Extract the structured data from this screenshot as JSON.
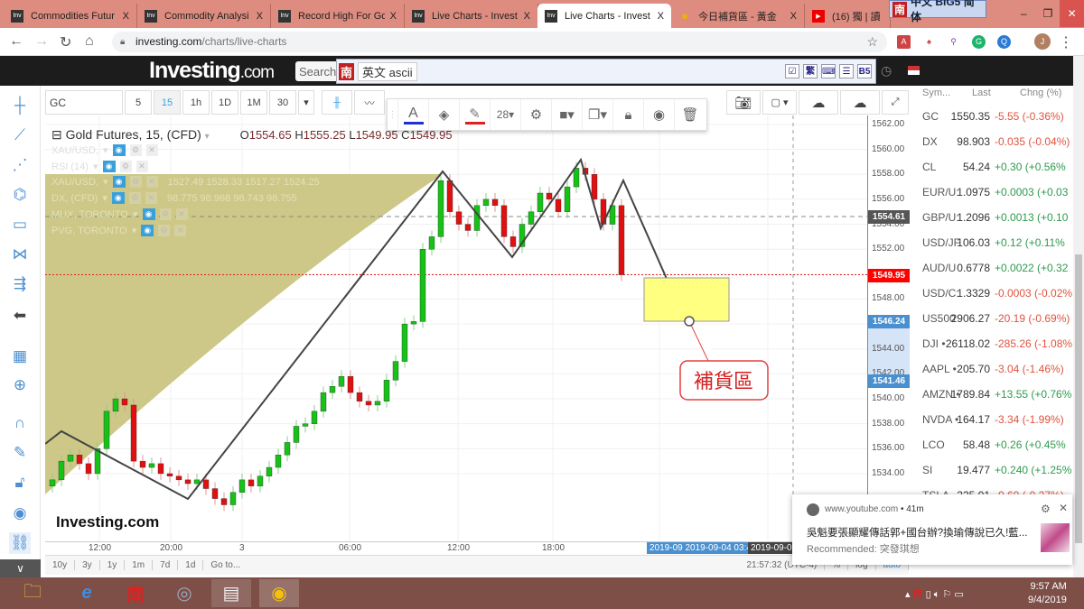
{
  "browser": {
    "tabs": [
      {
        "label": "Commodities Futur",
        "icon": "inv"
      },
      {
        "label": "Commodity Analysi",
        "icon": "inv"
      },
      {
        "label": "Record High For Go",
        "icon": "inv"
      },
      {
        "label": "Live Charts - Invest",
        "icon": "inv"
      },
      {
        "label": "Live Charts - Invest",
        "icon": "inv",
        "active": true
      },
      {
        "label": "今日補貨區 - 黃金",
        "icon": "bulb"
      },
      {
        "label": "(16) 獨 | 讀",
        "icon": "youtube"
      }
    ],
    "close_glyph": "X",
    "url_host": "investing.com",
    "url_path": "/charts/live-charts",
    "profile_initial": "J"
  },
  "ime": {
    "top_label": "中文 BIG5 简体",
    "top_logo": "南",
    "bar_logo": "南",
    "bar_mode": "英文 ascii",
    "trad": "繁",
    "b5": "B5"
  },
  "site": {
    "logo": "Investing",
    "logo_suffix": ".com",
    "search_placeholder": "Search"
  },
  "toolbar": {
    "symbol": "GC",
    "intervals": [
      "5",
      "15",
      "1h",
      "1D",
      "1M",
      "30"
    ],
    "selected_interval": "15"
  },
  "draw_toolbar": {
    "font_size": "28",
    "text_color": "#1f2fd6",
    "line_color": "#e02020"
  },
  "legend": {
    "title": "Gold Futures, 15, (CFD)",
    "ohlc": {
      "O": "1554.65",
      "H": "1555.25",
      "L": "1549.95",
      "C": "1549.95"
    },
    "overlays": [
      {
        "name": "XAU/USD,",
        "values": ""
      },
      {
        "name": "RSI (14)",
        "values": ""
      },
      {
        "name": "XAU/USD,",
        "values": "1527.49   1528.33   1517.27   1524.25"
      },
      {
        "name": "DX, (CFD)",
        "values": "98.775   98.968   98.743   98.755"
      },
      {
        "name": "MUX, TORONTO",
        "values": ""
      },
      {
        "name": "PVG, TORONTO",
        "values": ""
      }
    ]
  },
  "chart_data": {
    "type": "candlestick",
    "title": "Gold Futures, 15, (CFD)",
    "first_open": 1533.0,
    "closes": [
      1533.5,
      1535,
      1535.5,
      1534.8,
      1534,
      1536,
      1539,
      1540,
      1539.5,
      1535,
      1534.5,
      1534.8,
      1534,
      1533.8,
      1533.5,
      1533.2,
      1533.5,
      1532.8,
      1532,
      1531.5,
      1532.5,
      1533.5,
      1533,
      1533.8,
      1534.5,
      1535.5,
      1536.5,
      1537.8,
      1538,
      1539,
      1540.5,
      1541,
      1541.8,
      1540.5,
      1539.8,
      1539.5,
      1539.8,
      1541.5,
      1543,
      1546,
      1546.2,
      1552,
      1553,
      1557.5,
      1555,
      1554,
      1553.5,
      1555.5,
      1556,
      1555.5,
      1553,
      1552.2,
      1554,
      1555,
      1556.5,
      1556,
      1555,
      1557,
      1558.5,
      1558,
      1556,
      1554,
      1555.5,
      1549.95
    ],
    "ylim": [
      1532,
      1563
    ],
    "y_ticks": [
      "1562.00",
      "1560.00",
      "1558.00",
      "1556.00",
      "1554.00",
      "1552.00",
      "1548.00",
      "1544.00",
      "1542.00",
      "1540.00",
      "1538.00",
      "1536.00",
      "1534.00"
    ],
    "x_ticks": [
      "12:00",
      "20:00",
      "3",
      "06:00",
      "12:00",
      "18:00"
    ],
    "price_tags": {
      "dashed_level": "1554.61",
      "last": "1549.95",
      "zone_top": "1546.24",
      "zone_bottom": "1541.46"
    },
    "time_tags": [
      "2019-09",
      "2019-09-04 03:4",
      "2019-09-0"
    ],
    "annotation": "補貨區",
    "watermark": "Investing.com"
  },
  "bottom_bar": {
    "ranges": [
      "10y",
      "3y",
      "1y",
      "1m",
      "7d",
      "1d",
      "Go to..."
    ],
    "clock": "21:57:32 (UTC-4)",
    "pct": "%",
    "log": "log",
    "auto": "auto"
  },
  "watchlist": {
    "headers": [
      "Sym...",
      "Last",
      "Chng (%)"
    ],
    "rows": [
      {
        "sym": "GC",
        "last": "1550.35",
        "chg": "-5.55 (-0.36%)",
        "dir": "dn"
      },
      {
        "sym": "DX",
        "last": "98.903",
        "chg": "-0.035 (-0.04%)",
        "dir": "dn"
      },
      {
        "sym": "CL",
        "last": "54.24",
        "chg": "+0.30 (+0.56%",
        "dir": "up"
      },
      {
        "sym": "EUR/U:",
        "last": "1.0975",
        "chg": "+0.0003 (+0.03",
        "dir": "up"
      },
      {
        "sym": "GBP/U:",
        "last": "1.2096",
        "chg": "+0.0013 (+0.10",
        "dir": "up"
      },
      {
        "sym": "USD/JF",
        "last": "106.03",
        "chg": "+0.12 (+0.11%",
        "dir": "up"
      },
      {
        "sym": "AUD/U",
        "last": "0.6778",
        "chg": "+0.0022 (+0.32",
        "dir": "up"
      },
      {
        "sym": "USD/C:",
        "last": "1.3329",
        "chg": "-0.0003 (-0.02%",
        "dir": "dn"
      },
      {
        "sym": "US500",
        "last": "2906.27",
        "chg": "-20.19 (-0.69%)",
        "dir": "dn"
      },
      {
        "sym": "DJI •",
        "last": "26118.02",
        "chg": "-285.26 (-1.08%",
        "dir": "dn"
      },
      {
        "sym": "AAPL •",
        "last": "205.70",
        "chg": "-3.04 (-1.46%)",
        "dir": "dn"
      },
      {
        "sym": "AMZN •",
        "last": "1789.84",
        "chg": "+13.55 (+0.76%",
        "dir": "up"
      },
      {
        "sym": "NVDA •",
        "last": "164.17",
        "chg": "-3.34 (-1.99%)",
        "dir": "dn"
      },
      {
        "sym": "LCO",
        "last": "58.48",
        "chg": "+0.26 (+0.45%",
        "dir": "up"
      },
      {
        "sym": "SI",
        "last": "19.477",
        "chg": "+0.240 (+1.25%",
        "dir": "up"
      },
      {
        "sym": "TSLA",
        "last": "225.01",
        "chg": "-0.60 (-0.27%)",
        "dir": "dn"
      }
    ]
  },
  "notification": {
    "source": "www.youtube.com",
    "age": "• 41m",
    "title": "吳魁要張顯耀傳話郭+國台辦?換瑜傳說已久!藍...",
    "recommended_label": "Recommended:",
    "recommended_value": "突發琪想"
  },
  "taskbar": {
    "time": "9:57 AM",
    "date": "9/4/2019"
  }
}
